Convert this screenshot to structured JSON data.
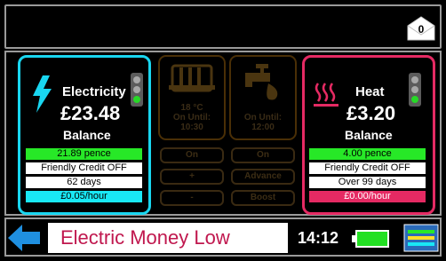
{
  "header": {
    "message_count": "0"
  },
  "electricity": {
    "title": "Electricity",
    "amount": "£23.48",
    "balance_label": "Balance",
    "rows": [
      "21.89 pence",
      "Friendly Credit OFF",
      "62 days",
      "£0.05/hour"
    ],
    "colors": {
      "border": "#19d6f0",
      "rate_bg": "#27e827",
      "last_row_bg": "#19e8f5"
    }
  },
  "heat": {
    "title": "Heat",
    "amount": "£3.20",
    "balance_label": "Balance",
    "rows": [
      "4.00 pence",
      "Friendly Credit OFF",
      "Over 99 days",
      "£0.00/hour"
    ],
    "colors": {
      "border": "#e52a63",
      "rate_bg": "#27e827",
      "last_row_bg": "#e52a63"
    }
  },
  "heating_control": {
    "temperature": "18 °C",
    "on_until_label": "On Until:",
    "on_until_time": "10:30",
    "buttons": [
      "On",
      "+",
      "-"
    ]
  },
  "water_control": {
    "on_until_label": "On Until:",
    "on_until_time": "12:00",
    "buttons": [
      "On",
      "Advance",
      "Boost"
    ]
  },
  "footer": {
    "alert_text": "Electric Money Low",
    "time": "14:12",
    "battery_color": "#22e022"
  }
}
